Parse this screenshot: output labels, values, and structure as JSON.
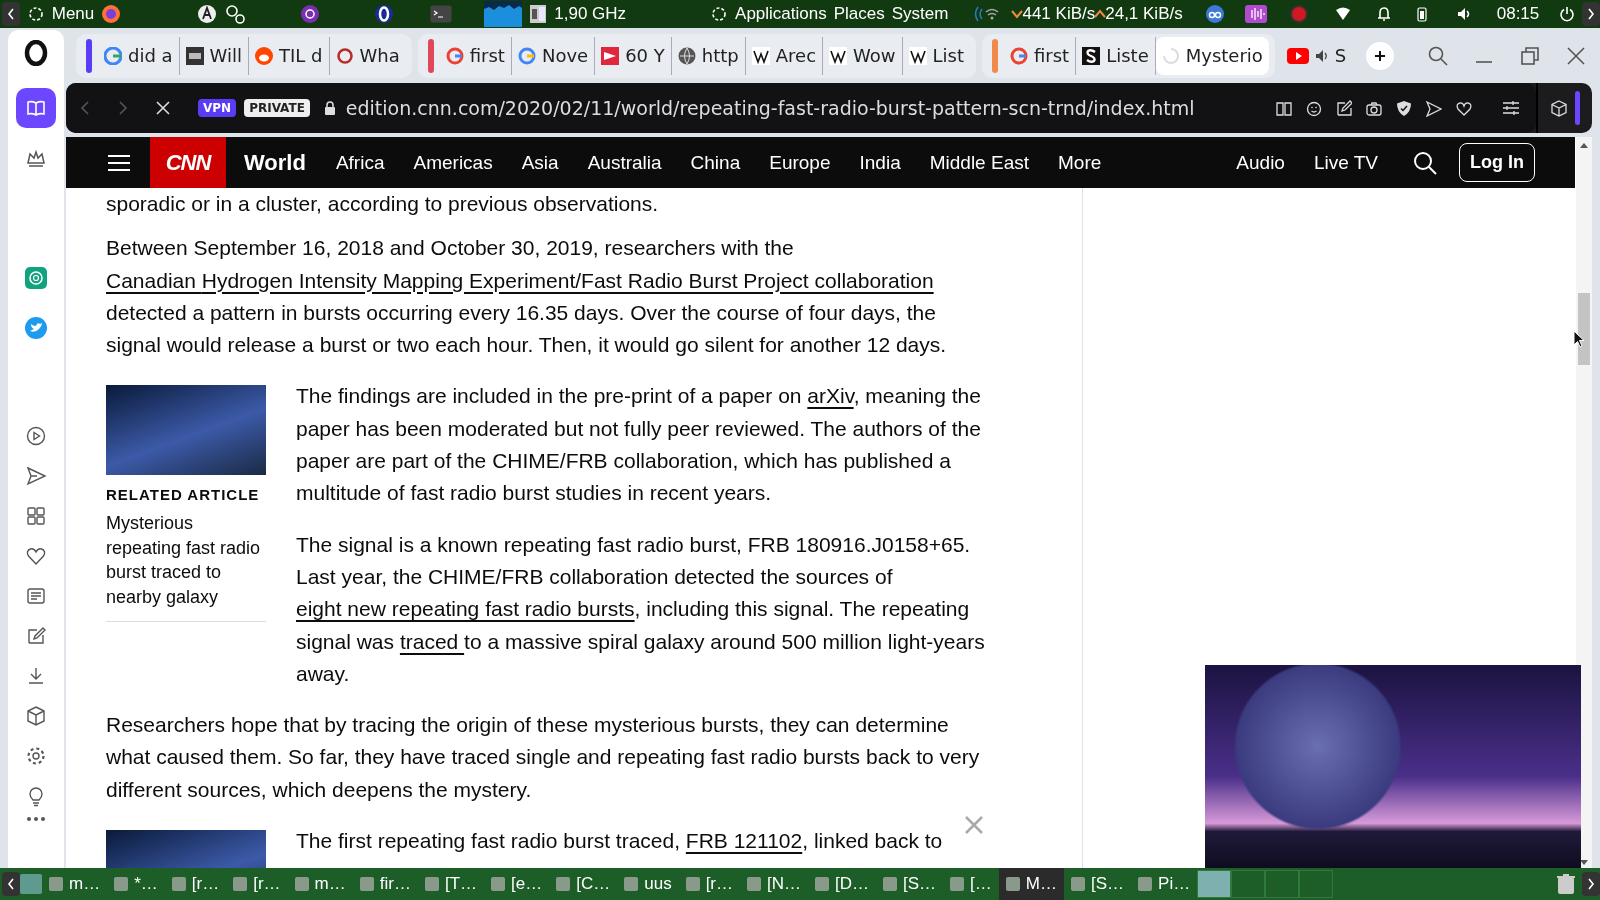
{
  "top_panel": {
    "menu": "Menu",
    "cpu": "1,90 GHz",
    "menus": [
      "Applications",
      "Places",
      "System"
    ],
    "download": "441 KiB/s",
    "upload": "24,1 KiB/s",
    "clock": "08:15"
  },
  "sidebar": {
    "items": [
      {
        "selected": true
      },
      {
        "selected": false
      },
      {
        "selected": false
      },
      {
        "selected": false
      },
      {
        "selected": false
      },
      {
        "selected": false
      },
      {
        "selected": false
      },
      {
        "selected": false
      },
      {
        "selected": false
      },
      {
        "selected": false
      },
      {
        "selected": false
      },
      {
        "selected": false
      },
      {
        "selected": false
      },
      {
        "selected": false
      }
    ]
  },
  "tabs": {
    "groups": [
      {
        "color": "#5b3cf5",
        "tabs": [
          {
            "title": "did a",
            "selected": false
          },
          {
            "title": "Will",
            "selected": false
          },
          {
            "title": "TIL d",
            "selected": false
          },
          {
            "title": "Wha",
            "selected": false
          }
        ]
      },
      {
        "color": "#e0485a",
        "tabs": [
          {
            "title": "first",
            "selected": false
          },
          {
            "title": "Nove",
            "selected": false
          },
          {
            "title": "60 Y",
            "selected": false
          },
          {
            "title": "http",
            "selected": false
          },
          {
            "title": "Arec",
            "selected": false
          },
          {
            "title": "Wow",
            "selected": false
          },
          {
            "title": "List",
            "selected": false
          }
        ]
      },
      {
        "color": "#f08a4b",
        "tabs": [
          {
            "title": "first",
            "selected": false
          },
          {
            "title": "Liste",
            "selected": false
          },
          {
            "title": "Mysterio",
            "selected": true
          }
        ]
      }
    ],
    "loose": [
      {
        "title": "S",
        "selected": false
      }
    ]
  },
  "address_bar": {
    "nav": [
      {
        "disabled": true
      },
      {
        "disabled": true
      },
      {
        "disabled": false
      }
    ],
    "vpn": "VPN",
    "private": "PRIVATE",
    "url": "edition.cnn.com/2020/02/11/world/repeating-fast-radio-burst-pattern-scn-trnd/index.html"
  },
  "cnn_nav": {
    "logo": "CNN",
    "section": "World",
    "items": [
      "Africa",
      "Americas",
      "Asia",
      "Australia",
      "China",
      "Europe",
      "India",
      "Middle East",
      "More"
    ],
    "right": [
      "Audio",
      "Live TV"
    ],
    "login": "Log In"
  },
  "article": {
    "blocks": [
      {
        "kind": "paragraph",
        "segments": [
          {
            "text": "sporadic or in a cluster, according to previous observations.",
            "kind": "text"
          }
        ]
      },
      {
        "kind": "paragraph",
        "segments": [
          {
            "text": "Between September 16, 2018 and October 30, 2019, researchers with the ",
            "kind": "text"
          },
          {
            "text": "Canadian ",
            "kind": "link"
          },
          {
            "text": "Hydrogen Intensity Mapping Experiment/Fast Radio Burst Project collaboration",
            "kind": "link"
          },
          {
            "text": " detected a pattern in bursts occurring every 16.35 days. Over the course of four days, the signal would release a burst or two each hour. Then, it would go silent for another 12 days.",
            "kind": "text"
          }
        ]
      },
      {
        "kind": "related",
        "label": "RELATED ARTICLE",
        "title": "Mysterious repeating fast radio burst traced to nearby galaxy"
      },
      {
        "kind": "paragraph",
        "segments": [
          {
            "text": "The findings are included in the pre-print of a paper on ",
            "kind": "text"
          },
          {
            "text": "arXiv",
            "kind": "link"
          },
          {
            "text": ", meaning the paper has been moderated but not fully peer reviewed. The authors of the paper are part of the CHIME/FRB collaboration, which has published a multitude of fast radio burst studies in recent years.",
            "kind": "text"
          }
        ]
      },
      {
        "kind": "paragraph",
        "segments": [
          {
            "text": "The signal is a known repeating fast radio burst, FRB 180916.J0158+65. Last year, the CHIME/FRB collaboration detected the sources of ",
            "kind": "text"
          },
          {
            "text": "eight new repeating fast radio bursts",
            "kind": "link"
          },
          {
            "text": ", including this signal. The repeating signal was ",
            "kind": "text"
          },
          {
            "text": "traced ",
            "kind": "link"
          },
          {
            "text": "to a massive spiral galaxy around 500 million light-years away.",
            "kind": "text"
          }
        ]
      },
      {
        "kind": "paragraph",
        "segments": [
          {
            "text": "Researchers hope that by tracing the origin of these mysterious bursts, they can determine what caused them. So far, they have traced single and repeating fast radio bursts back to very different sources, which deepens the mystery.",
            "kind": "text"
          }
        ]
      },
      {
        "kind": "related"
      },
      {
        "kind": "paragraph",
        "segments": [
          {
            "text": "The first repeating fast radio burst traced, ",
            "kind": "text"
          },
          {
            "text": "FRB 121102",
            "kind": "link"
          },
          {
            "text": ", linked back to",
            "kind": "text"
          }
        ]
      }
    ]
  },
  "taskbar": {
    "items": [
      {
        "title": "m…",
        "selected": false
      },
      {
        "title": "*…",
        "selected": false
      },
      {
        "title": "[r…",
        "selected": false
      },
      {
        "title": "[r…",
        "selected": false
      },
      {
        "title": "m…",
        "selected": false
      },
      {
        "title": "fir…",
        "selected": false
      },
      {
        "title": "[T…",
        "selected": false
      },
      {
        "title": "[e…",
        "selected": false
      },
      {
        "title": "[C…",
        "selected": false
      },
      {
        "title": "uus",
        "selected": false
      },
      {
        "title": "[r…",
        "selected": false
      },
      {
        "title": "[N…",
        "selected": false
      },
      {
        "title": "[D…",
        "selected": false
      },
      {
        "title": "[S…",
        "selected": false
      },
      {
        "title": "[…",
        "selected": false
      },
      {
        "title": "M…",
        "selected": true
      },
      {
        "title": "[S…",
        "selected": false
      },
      {
        "title": "Pi…",
        "selected": false
      }
    ],
    "workspaces": [
      {
        "selected": true
      },
      {
        "selected": false
      },
      {
        "selected": false
      },
      {
        "selected": false
      }
    ]
  }
}
